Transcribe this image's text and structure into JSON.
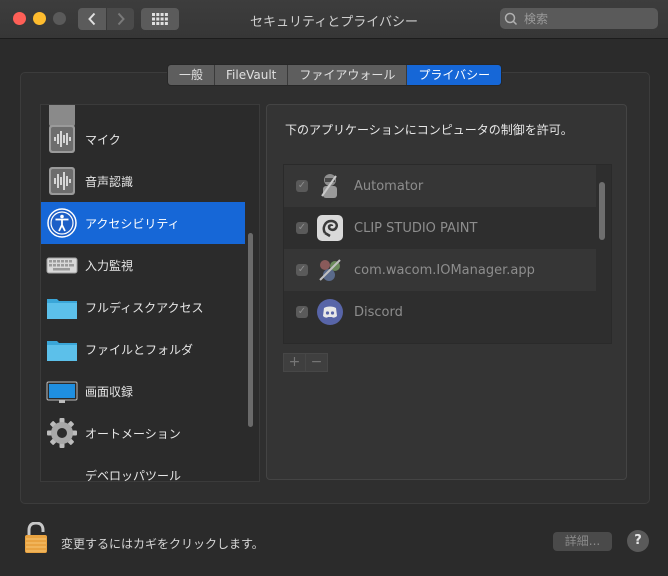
{
  "window": {
    "title": "セキュリティとプライバシー",
    "search_placeholder": "検索"
  },
  "tabs": [
    {
      "label": "一般",
      "active": false
    },
    {
      "label": "FileVault",
      "active": false
    },
    {
      "label": "ファイアウォール",
      "active": false
    },
    {
      "label": "プライバシー",
      "active": true
    }
  ],
  "sidebar": {
    "items": [
      {
        "label": "マイク",
        "icon": "microphone-icon"
      },
      {
        "label": "音声認識",
        "icon": "speech-recognition-icon"
      },
      {
        "label": "アクセシビリティ",
        "icon": "accessibility-icon",
        "selected": true
      },
      {
        "label": "入力監視",
        "icon": "keyboard-icon"
      },
      {
        "label": "フルディスクアクセス",
        "icon": "folder-icon"
      },
      {
        "label": "ファイルとフォルダ",
        "icon": "folder-icon"
      },
      {
        "label": "画面収録",
        "icon": "display-icon"
      },
      {
        "label": "オートメーション",
        "icon": "gear-icon"
      },
      {
        "label": "デベロッパツール",
        "icon": "developer-tools-icon"
      }
    ]
  },
  "panel": {
    "title": "下のアプリケーションにコンピュータの制御を許可。",
    "apps": [
      {
        "name": "Automator",
        "checked": true,
        "icon": "automator-icon"
      },
      {
        "name": "CLIP STUDIO PAINT",
        "checked": true,
        "icon": "clip-studio-icon"
      },
      {
        "name": "com.wacom.IOManager.app",
        "checked": true,
        "icon": "wacom-icon"
      },
      {
        "name": "Discord",
        "checked": true,
        "icon": "discord-icon"
      }
    ],
    "add_label": "+",
    "remove_label": "−"
  },
  "footer": {
    "lock_text": "変更するにはカギをクリックします。",
    "advanced_label": "詳細...",
    "help_label": "?"
  },
  "colors": {
    "accent": "#1667d7",
    "background": "#2b2b2b"
  }
}
